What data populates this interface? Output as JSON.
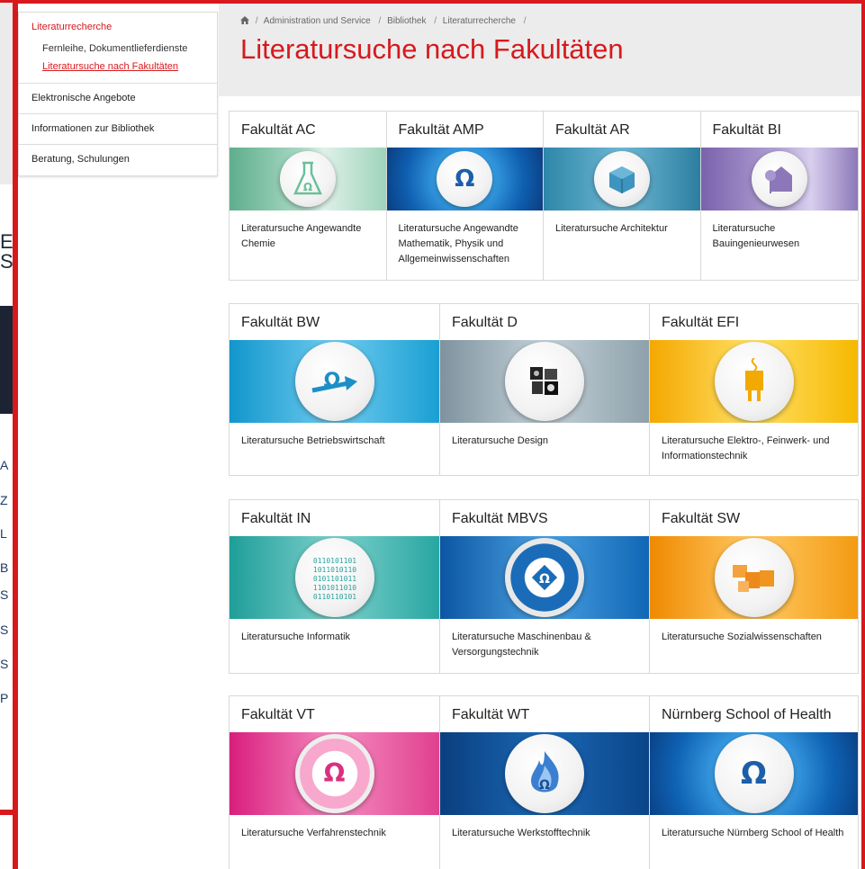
{
  "sidebar": {
    "section_title": "Literaturrecherche",
    "sub_items": [
      "Fernleihe, Dokumentlieferdienste",
      "Literatursuche nach Fakultäten"
    ],
    "items": [
      "Elektronische Angebote",
      "Informationen zur Bibliothek",
      "Beratung, Schulungen"
    ]
  },
  "breadcrumb": {
    "home_icon": "home-icon",
    "items": [
      "Administration und Service",
      "Bibliothek",
      "Literaturrecherche"
    ]
  },
  "page_title": "Literatursuche nach Fakultäten",
  "background": {
    "big_letters": [
      "E",
      "S"
    ],
    "side_letters": [
      "A",
      "Z",
      "L",
      "B",
      "S",
      "S",
      "S",
      "P"
    ]
  },
  "groups": [
    {
      "cards": [
        {
          "title": "Fakultät AC",
          "description": "Literatursuche Angewandte Chemie",
          "icon": "flask-icon",
          "theme": "green"
        },
        {
          "title": "Fakultät AMP",
          "description": "Literatursuche Angewandte Mathematik, Physik und Allgemeinwissenschaften",
          "icon": "logo-icon",
          "theme": "blue"
        },
        {
          "title": "Fakultät AR",
          "description": "Literatursuche Architektur",
          "icon": "cube-icon",
          "theme": "teal"
        },
        {
          "title": "Fakultät BI",
          "description": "Literatursuche Bauingenieurwesen",
          "icon": "house-icon",
          "theme": "purple"
        }
      ]
    },
    {
      "cards": [
        {
          "title": "Fakultät BW",
          "description": "Literatursuche Betriebswirtschaft",
          "icon": "arrow-logo-icon",
          "theme": "cyan"
        },
        {
          "title": "Fakultät D",
          "description": "Literatursuche Design",
          "icon": "collage-icon",
          "theme": "grey"
        },
        {
          "title": "Fakultät EFI",
          "description": "Literatursuche Elektro-, Feinwerk- und Informationstechnik",
          "icon": "plug-icon",
          "theme": "yellow"
        }
      ]
    },
    {
      "cards": [
        {
          "title": "Fakultät IN",
          "description": "Literatursuche Informatik",
          "icon": "binary-icon",
          "theme": "turquoise"
        },
        {
          "title": "Fakultät MBVS",
          "description": "Literatursuche Maschinenbau & Versorgungstechnik",
          "icon": "gear-icon",
          "theme": "navy"
        },
        {
          "title": "Fakultät SW",
          "description": "Literatursuche Sozialwissenschaften",
          "icon": "blocks-icon",
          "theme": "orange"
        }
      ]
    },
    {
      "cards": [
        {
          "title": "Fakultät VT",
          "description": "Literatursuche Verfahrenstechnik",
          "icon": "cycle-icon",
          "theme": "pink"
        },
        {
          "title": "Fakultät WT",
          "description": "Literatursuche Werkstofftechnik",
          "icon": "flame-icon",
          "theme": "darkblue"
        },
        {
          "title": "Nürnberg School of Health",
          "description": "Literatursuche Nürnberg School of Health",
          "icon": "logo-icon",
          "theme": "lightblue"
        }
      ]
    }
  ],
  "colors": {
    "accent": "#d7191d",
    "green": "#7fc3a6",
    "blue": "#1f86d1",
    "teal": "#3b93b5",
    "purple": "#8c78b8",
    "cyan": "#27a6d6",
    "grey": "#8fa2ad",
    "yellow": "#f2b51b",
    "turquoise": "#2aa8a4",
    "navy": "#1d6fb3",
    "orange": "#f29a1c",
    "pink": "#e2418e",
    "darkblue": "#0f4d93",
    "lightblue": "#1a7cc6"
  }
}
